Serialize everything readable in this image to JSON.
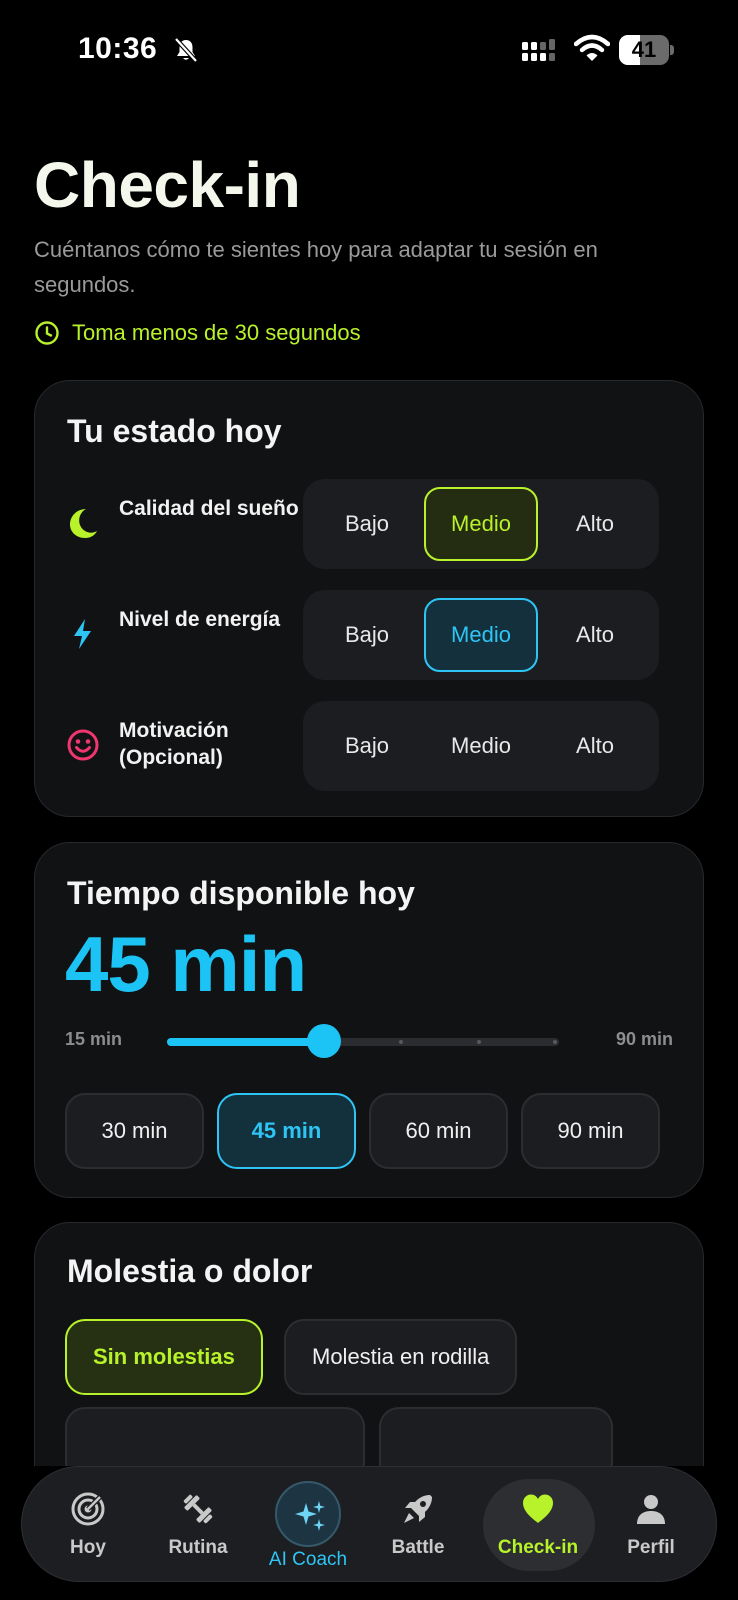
{
  "status_bar": {
    "time": "10:36",
    "battery": "41",
    "battery_level": 0.41
  },
  "header": {
    "title": "Check-in",
    "subtitle": "Cuéntanos cómo te sientes hoy para adaptar tu sesión en segundos.",
    "time_hint": "Toma menos de 30 segundos"
  },
  "colors": {
    "accent_green": "#b8f22a",
    "accent_blue": "#2ec5f5",
    "accent_pink": "#f0366f",
    "background": "#000000",
    "card": "#111214"
  },
  "state_card": {
    "title": "Tu estado hoy",
    "rows": [
      {
        "icon": "moon-icon",
        "label": "Calidad del sueño",
        "options": [
          "Bajo",
          "Medio",
          "Alto"
        ],
        "selected": "Medio"
      },
      {
        "icon": "bolt-icon",
        "label": "Nivel de energía",
        "options": [
          "Bajo",
          "Medio",
          "Alto"
        ],
        "selected": "Medio"
      },
      {
        "icon": "smiley-icon",
        "label": "Motivación (Opcional)",
        "options": [
          "Bajo",
          "Medio",
          "Alto"
        ],
        "selected": ""
      }
    ]
  },
  "time_card": {
    "title": "Tiempo disponible hoy",
    "value": "45 min",
    "slider": {
      "min_label": "15 min",
      "max_label": "90 min",
      "min": 15,
      "max": 90,
      "value": 45
    },
    "chips": [
      "30 min",
      "45 min",
      "60 min",
      "90 min"
    ],
    "selected": "45 min"
  },
  "pain_card": {
    "title": "Molestia o dolor",
    "chips": [
      "Sin molestias",
      "Molestia en rodilla"
    ],
    "selected": "Sin molestias"
  },
  "bottom_nav": {
    "items": [
      {
        "id": "hoy",
        "label": "Hoy",
        "icon": "target-icon"
      },
      {
        "id": "rutina",
        "label": "Rutina",
        "icon": "dumbbell-icon"
      },
      {
        "id": "ai-coach",
        "label": "AI Coach",
        "icon": "sparkles-icon"
      },
      {
        "id": "battle",
        "label": "Battle",
        "icon": "rocket-icon"
      },
      {
        "id": "check-in",
        "label": "Check-in",
        "icon": "heart-icon"
      },
      {
        "id": "perfil",
        "label": "Perfil",
        "icon": "person-icon"
      }
    ],
    "active": "Check-in"
  }
}
